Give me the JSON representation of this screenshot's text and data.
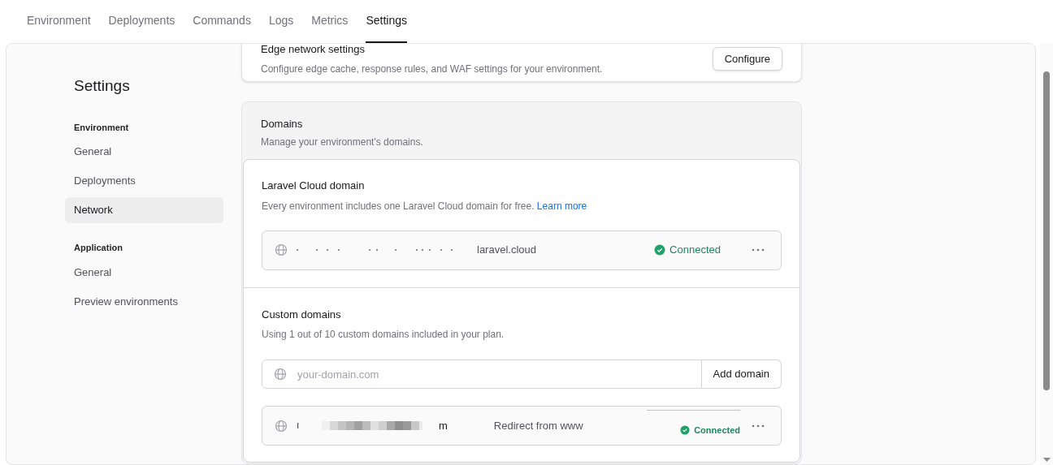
{
  "tabs": [
    {
      "label": "Environment",
      "selected": false
    },
    {
      "label": "Deployments",
      "selected": false
    },
    {
      "label": "Commands",
      "selected": false
    },
    {
      "label": "Logs",
      "selected": false
    },
    {
      "label": "Metrics",
      "selected": false
    },
    {
      "label": "Settings",
      "selected": true
    }
  ],
  "sidebar": {
    "title": "Settings",
    "groups": [
      {
        "heading": "Environment",
        "items": [
          {
            "label": "General",
            "selected": false
          },
          {
            "label": "Deployments",
            "selected": false
          },
          {
            "label": "Network",
            "selected": true
          }
        ]
      },
      {
        "heading": "Application",
        "items": [
          {
            "label": "General",
            "selected": false
          },
          {
            "label": "Preview environments",
            "selected": false
          }
        ]
      }
    ]
  },
  "edge_card": {
    "title": "Edge network settings",
    "description": "Configure edge cache, response rules, and WAF settings for your environment.",
    "button": "Configure"
  },
  "domains": {
    "title": "Domains",
    "description": "Manage your environment's domains.",
    "cloud_domain": {
      "title": "Laravel Cloud domain",
      "description": "Every environment includes one Laravel Cloud domain for free.",
      "link": "Learn more",
      "domain": "laravel.cloud",
      "status": "Connected"
    },
    "custom_domains": {
      "title": "Custom domains",
      "description": "Using 1 out of 10 custom domains included in your plan.",
      "placeholder": "your-domain.com",
      "button": "Add domain",
      "rows": [
        {
          "domain": "m",
          "note": "Redirect from www",
          "status": "Connected"
        }
      ]
    }
  }
}
